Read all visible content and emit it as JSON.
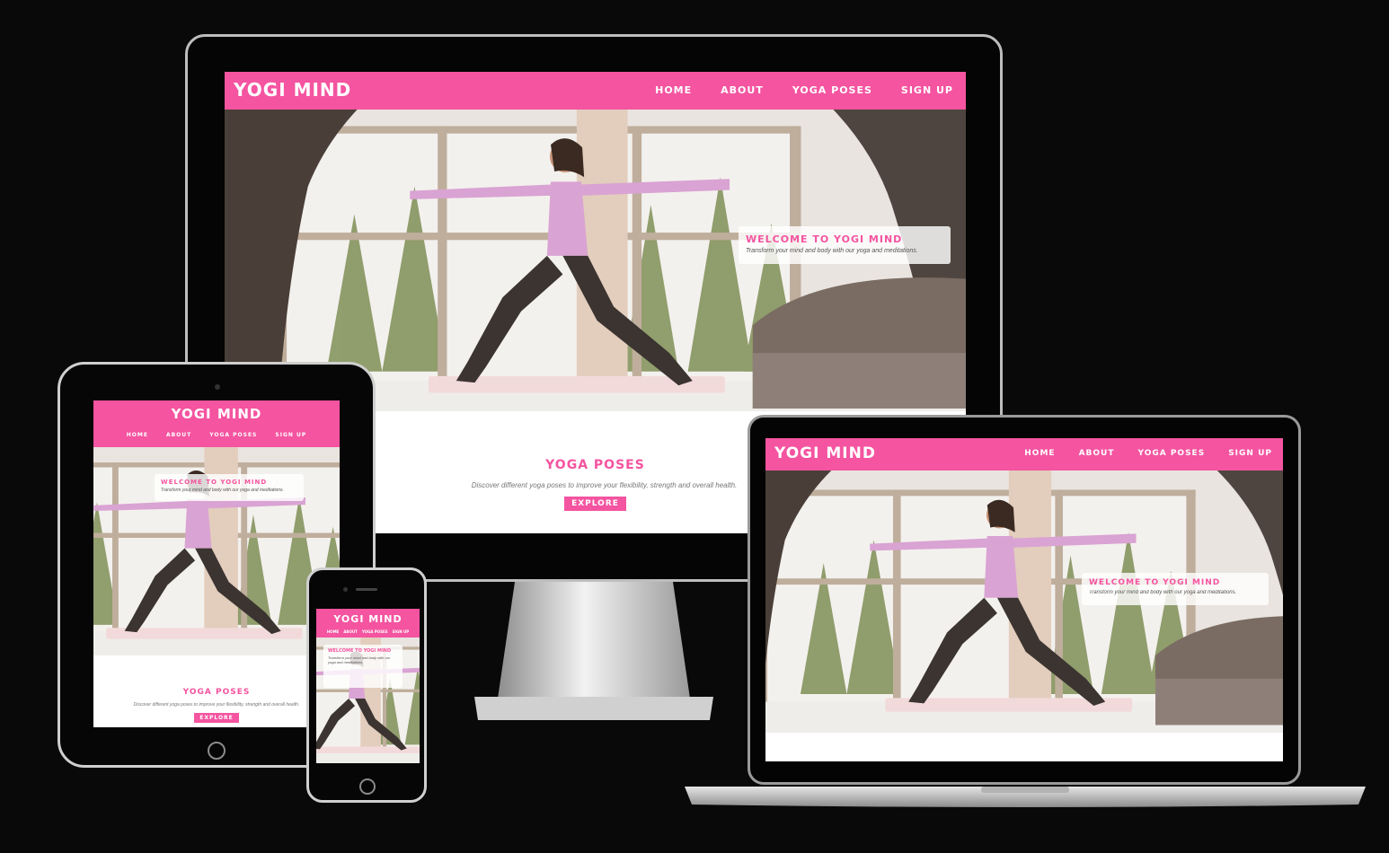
{
  "site": {
    "brand": "YOGI MIND",
    "nav": [
      "HOME",
      "ABOUT",
      "YOGA POSES",
      "SIGN UP"
    ],
    "welcome_title": "WELCOME TO YOGI MIND",
    "welcome_text": "Transform your mind and body with our yoga and meditations.",
    "poses_title": "YOGA POSES",
    "poses_text": "Discover different yoga poses to improve your flexibility, strength and overall health.",
    "explore_label": "EXPLORE"
  },
  "colors": {
    "accent": "#f454a0",
    "page_background": "#0a0909",
    "device_frame": "#050505"
  },
  "devices": [
    "desktop-monitor",
    "tablet",
    "smartphone",
    "laptop"
  ]
}
